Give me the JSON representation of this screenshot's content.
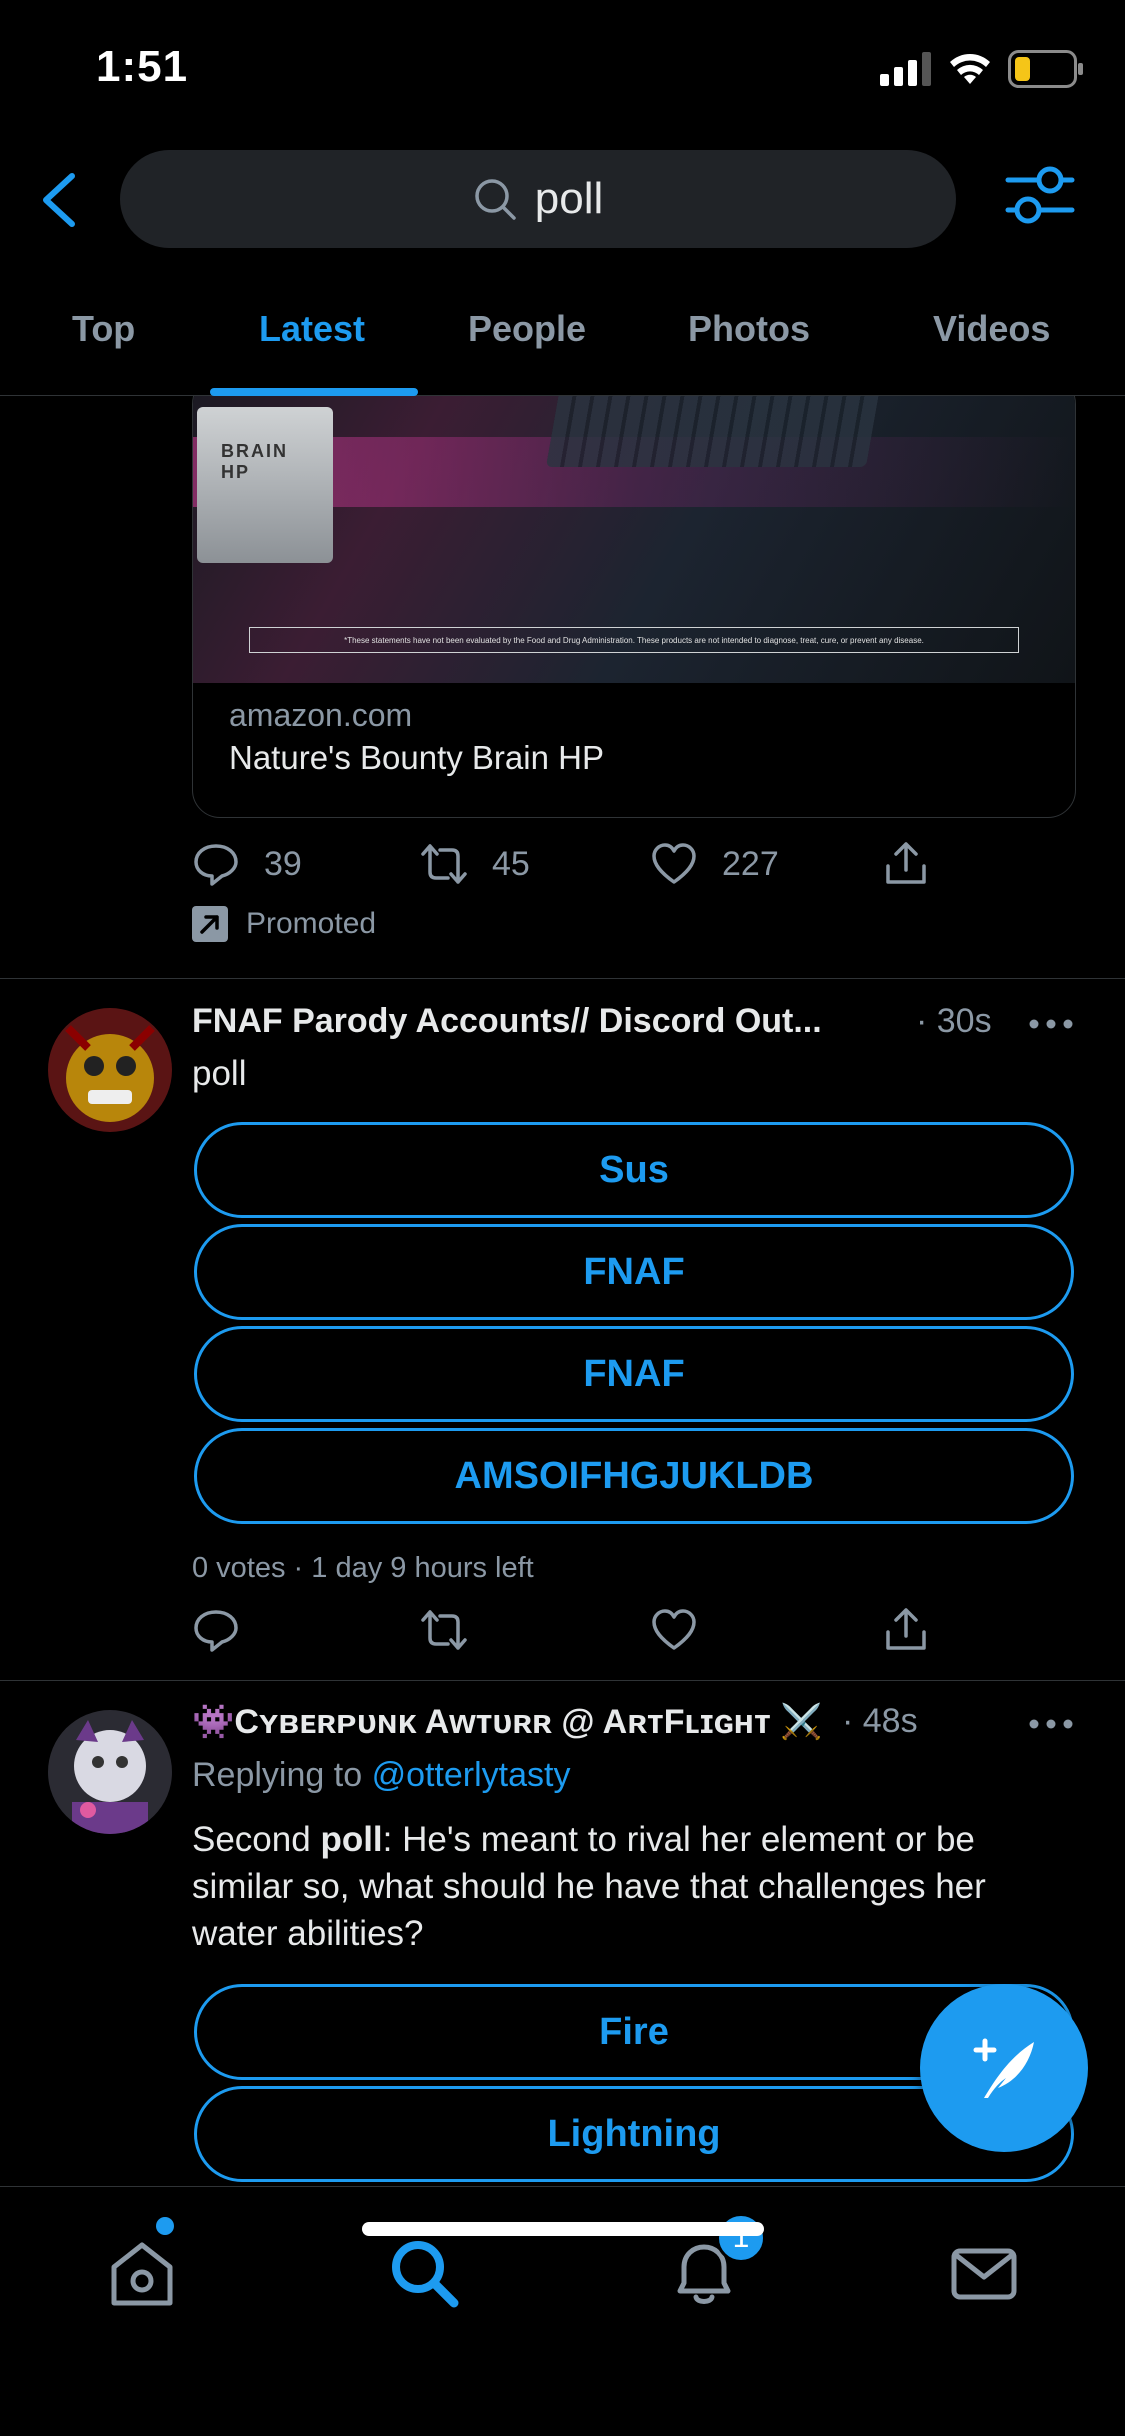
{
  "status_bar": {
    "time": "1:51"
  },
  "search": {
    "query": "poll"
  },
  "tabs": [
    {
      "label": "Top"
    },
    {
      "label": "Latest"
    },
    {
      "label": "People"
    },
    {
      "label": "Photos"
    },
    {
      "label": "Videos"
    }
  ],
  "active_tab": "Latest",
  "promo": {
    "product_brand": "BRAIN",
    "product_sub": "HP",
    "disclaimer": "*These statements have not been evaluated by the Food and Drug Administration. These products are not intended to diagnose, treat, cure, or prevent any disease.",
    "domain": "amazon.com",
    "title": "Nature's Bounty Brain HP",
    "replies": "39",
    "retweets": "45",
    "likes": "227",
    "promoted_label": "Promoted"
  },
  "tweet1": {
    "name": "FNAF Parody Accounts// Discord Out...",
    "time": "· 30s",
    "text": "poll",
    "options": [
      "Sus",
      "FNAF",
      "FNAF",
      "AMSOIFHGJUKLDB"
    ],
    "meta": "0 votes · 1 day 9 hours left"
  },
  "tweet2": {
    "name": "👾Cʏʙᴇʀᴘᴜɴᴋ Aᴡᴛᴜʀʀ @ AʀᴛFʟɪɢʜᴛ ⚔️",
    "time": "· 48s",
    "replying_prefix": "Replying to",
    "replying_handle": "@otterlytasty",
    "text_before": "Second ",
    "text_bold": "poll",
    "text_after": ": He's meant to rival her element or be similar so, what should he have that challenges her water abilities?",
    "options": [
      "Fire",
      "Lightning"
    ]
  },
  "bottom_nav": {
    "notifications_badge": "1"
  },
  "colors": {
    "accent": "#1d9bf0",
    "background": "#000000",
    "secondary_text": "#8b98a5",
    "divider": "#2f3336"
  }
}
